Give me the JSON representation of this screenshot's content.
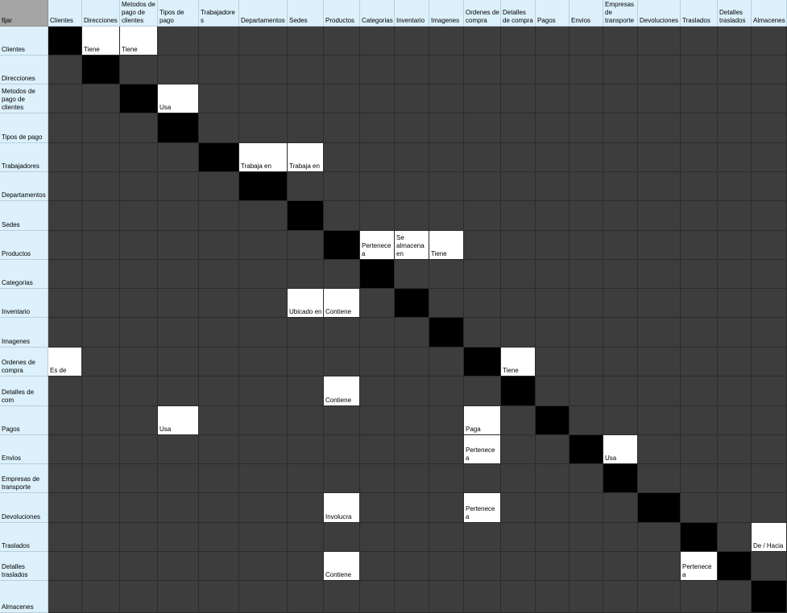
{
  "corner_label": "fijar",
  "columns": [
    "Clientes",
    "Direcciones",
    "Metodos de pago de clientes",
    "Tipos de pago",
    "Trabajadores",
    "Departamentos",
    "Sedes",
    "Productos",
    "Categorias",
    "Inventario",
    "Imagenes",
    "Ordenes de compra",
    "Detalles de compra",
    "Pagos",
    "Envios",
    "Empresas de transporte",
    "Devoluciones",
    "Traslados",
    "Detalles traslados",
    "Almacenes"
  ],
  "rows": [
    "Clientes",
    "Direcciones",
    "Metodos de pago de clientes",
    "Tipos de pago",
    "Trabajadores",
    "Departamentos",
    "Sedes",
    "Productos",
    "Categorias",
    "Inventario",
    "Imagenes",
    "Ordenes de compra",
    "Detalles de com",
    "Pagos",
    "Envios",
    "Empresas de transporte",
    "Devoluciones",
    "Traslados",
    "Detalles traslados",
    "Almacenes"
  ],
  "relations": [
    {
      "row": 0,
      "col": 1,
      "text": "Tiene"
    },
    {
      "row": 0,
      "col": 2,
      "text": "Tiene"
    },
    {
      "row": 2,
      "col": 3,
      "text": "Usa"
    },
    {
      "row": 4,
      "col": 5,
      "text": "Trabaja en"
    },
    {
      "row": 4,
      "col": 6,
      "text": "Trabaja en"
    },
    {
      "row": 7,
      "col": 8,
      "text": "Pertenece a"
    },
    {
      "row": 7,
      "col": 9,
      "text": "Se almacena en"
    },
    {
      "row": 7,
      "col": 10,
      "text": "Tiene"
    },
    {
      "row": 9,
      "col": 6,
      "text": "Ubicado en"
    },
    {
      "row": 9,
      "col": 7,
      "text": "Contiene"
    },
    {
      "row": 11,
      "col": 0,
      "text": "Es de"
    },
    {
      "row": 11,
      "col": 12,
      "text": "Tiene"
    },
    {
      "row": 12,
      "col": 7,
      "text": "Contiene"
    },
    {
      "row": 13,
      "col": 3,
      "text": "Usa"
    },
    {
      "row": 13,
      "col": 11,
      "text": "Paga"
    },
    {
      "row": 14,
      "col": 11,
      "text": "Pertenece a"
    },
    {
      "row": 14,
      "col": 15,
      "text": "Usa"
    },
    {
      "row": 16,
      "col": 7,
      "text": "Involucra"
    },
    {
      "row": 16,
      "col": 11,
      "text": "Pertenece a"
    },
    {
      "row": 17,
      "col": 19,
      "text": "De / Hacia"
    },
    {
      "row": 18,
      "col": 7,
      "text": "Contiene"
    },
    {
      "row": 18,
      "col": 17,
      "text": "Pertenece a"
    }
  ],
  "colors": {
    "header_bg": "#dcf1fb",
    "corner_bg": "#a5a5a5",
    "empty_bg": "#3d3d3d",
    "diagonal_bg": "#000000",
    "relation_bg": "#ffffff"
  }
}
